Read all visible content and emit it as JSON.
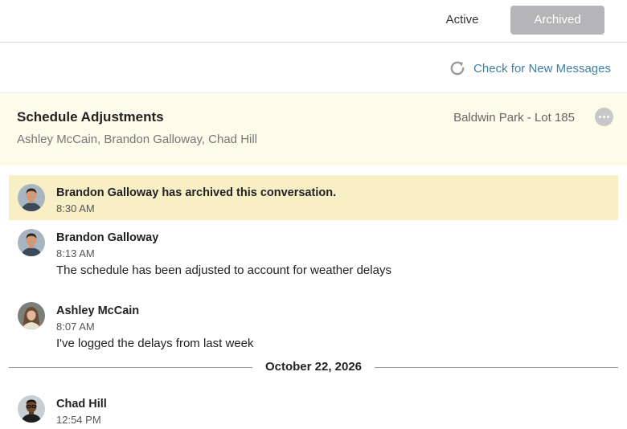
{
  "tabs": {
    "active": "Active",
    "archived": "Archived",
    "selected": "Archived"
  },
  "check_messages": {
    "label": "Check for New Messages",
    "icon": "refresh-icon"
  },
  "conversation": {
    "title": "Schedule Adjustments",
    "participants": "Ashley McCain, Brandon Galloway, Chad Hill",
    "location": "Baldwin Park - Lot 185"
  },
  "messages": [
    {
      "sender": "Brandon Galloway has archived this conversation.",
      "time": "8:30 AM",
      "system": true
    },
    {
      "sender": "Brandon Galloway",
      "time": "8:13 AM",
      "body": "The schedule has been adjusted to account for weather delays"
    },
    {
      "sender": "Ashley McCain",
      "time": "8:07 AM",
      "body": "I've logged the delays from last week"
    },
    {
      "sender": "Chad Hill",
      "time": "12:54 PM"
    }
  ],
  "date_divider": "October 22, 2026",
  "colors": {
    "accent_link": "#3f7ea6",
    "selected_tab_bg": "#b5b5b7",
    "header_bg": "#fdfbea",
    "system_message_bg": "#f8efc6"
  }
}
